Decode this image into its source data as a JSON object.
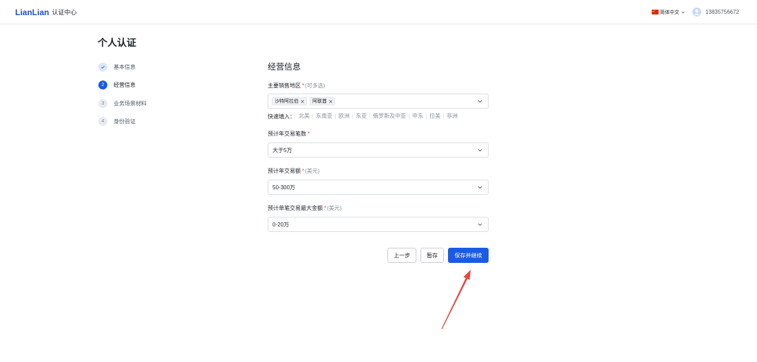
{
  "header": {
    "logo": "LianLian",
    "title": "认证中心",
    "language": "简体中文",
    "phone": "13835756672"
  },
  "page": {
    "title": "个人认证"
  },
  "steps": [
    {
      "label": "基本信息",
      "icon": "check-icon"
    },
    {
      "number": "2",
      "label": "经营信息"
    },
    {
      "number": "3",
      "label": "业务场景材料"
    },
    {
      "number": "4",
      "label": "身份验证"
    }
  ],
  "form": {
    "section_title": "经营信息",
    "sales_regions": {
      "label": "主要销售地区",
      "required_mark": "*",
      "hint": "(可多选)",
      "selected": [
        "沙特阿拉伯",
        "阿联酋"
      ],
      "quick_fill_label": "快速填入：",
      "quick_fill_options": [
        "北美",
        "东南亚",
        "欧洲",
        "东亚",
        "俄罗斯及中亚",
        "中东",
        "拉美",
        "非洲"
      ]
    },
    "annual_transaction_count": {
      "label": "预计年交易笔数",
      "required_mark": "*",
      "value": "大于5万"
    },
    "annual_transaction_amount": {
      "label": "预计年交易额",
      "required_mark": "*",
      "hint": "(美元)",
      "value": "50-300万"
    },
    "max_single_transaction": {
      "label": "预计单笔交易最大金额",
      "required_mark": "*",
      "hint": "(美元)",
      "value": "0-20万"
    }
  },
  "actions": {
    "previous": "上一步",
    "save_draft": "暂存",
    "save_continue": "保存并继续"
  },
  "icons": {
    "language": "china-flag-icon",
    "avatar": "user-avatar-icon",
    "dropdown": "chevron-down-icon",
    "tag_remove": "close-icon",
    "step_done": "check-icon"
  },
  "colors": {
    "primary": "#1a5be6",
    "logo": "#1a4fd1",
    "required": "#f53f3f",
    "annotation_arrow": "#e8473f"
  }
}
